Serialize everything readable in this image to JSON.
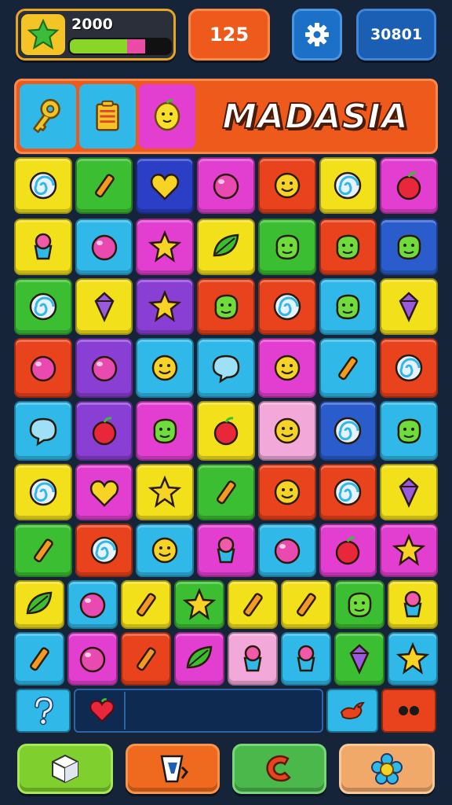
{
  "hud": {
    "score_value": "2000",
    "score_progress": 0.75,
    "score_pink_fraction": 0.18,
    "moves_value": "125",
    "code_value": "30801",
    "gem_icon": "green-star-gem-icon",
    "settings_icon": "gear-icon"
  },
  "title": {
    "text": "MADASIA",
    "tiles": [
      {
        "name": "key-icon",
        "color": "#2fb8e8"
      },
      {
        "name": "crate-icon",
        "color": "#2fb8e8"
      },
      {
        "name": "lemon-face-icon",
        "color": "#e23fd0"
      }
    ]
  },
  "board": {
    "rows": [
      [
        {
          "icon": "swirl-lollipop-icon",
          "color": "#f2e01b"
        },
        {
          "icon": "hammer-icon",
          "color": "#3cbe32"
        },
        {
          "icon": "heart-icon",
          "color": "#2a3ec6"
        },
        {
          "icon": "bubble-gum-icon",
          "color": "#e23fd0"
        },
        {
          "icon": "orange-face-icon",
          "color": "#e8431c"
        },
        {
          "icon": "pie-icon",
          "color": "#f2e01b"
        },
        {
          "icon": "peach-icon",
          "color": "#e23fd0"
        }
      ],
      [
        {
          "icon": "cupcake-icon",
          "color": "#f2e01b"
        },
        {
          "icon": "red-balloon-icon",
          "color": "#2fb8e8"
        },
        {
          "icon": "waffle-flower-icon",
          "color": "#e23fd0"
        },
        {
          "icon": "pepper-icon",
          "color": "#f2e01b"
        },
        {
          "icon": "green-blob-icon",
          "color": "#3cbe32"
        },
        {
          "icon": "owl-candy-icon",
          "color": "#e8431c"
        },
        {
          "icon": "orange-blob-icon",
          "color": "#2a5ccc"
        }
      ],
      [
        {
          "icon": "swirl-candy-icon",
          "color": "#3cbe32"
        },
        {
          "icon": "wrapped-candy-icon",
          "color": "#f2e01b"
        },
        {
          "icon": "crown-icon",
          "color": "#8a3fd4"
        },
        {
          "icon": "spiky-green-icon",
          "color": "#e8431c"
        },
        {
          "icon": "rainbow-swirl-icon",
          "color": "#e8431c"
        },
        {
          "icon": "purple-blob-icon",
          "color": "#2fb8e8"
        },
        {
          "icon": "bottle-icon",
          "color": "#f2e01b"
        }
      ],
      [
        {
          "icon": "balloons-icon",
          "color": "#e8431c"
        },
        {
          "icon": "grape-icon",
          "color": "#8a3fd4"
        },
        {
          "icon": "star-face-icon",
          "color": "#2fb8e8"
        },
        {
          "icon": "speech-bubble-icon",
          "color": "#2fb8e8"
        },
        {
          "icon": "smiley-icon",
          "color": "#e23fd0"
        },
        {
          "icon": "sparkle-stick-icon",
          "color": "#2fb8e8"
        },
        {
          "icon": "red-swirl-icon",
          "color": "#e8431c"
        }
      ],
      [
        {
          "icon": "magnifier-icon",
          "color": "#2fb8e8"
        },
        {
          "icon": "onion-icon",
          "color": "#8a3fd4"
        },
        {
          "icon": "red-splat-icon",
          "color": "#e23fd0"
        },
        {
          "icon": "watermelon-icon",
          "color": "#f2e01b"
        },
        {
          "icon": "cat-face-icon",
          "color": "#f2a8d8"
        },
        {
          "icon": "donut-icon",
          "color": "#2a5ccc"
        },
        {
          "icon": "purple-splat-icon",
          "color": "#2fb8e8"
        }
      ],
      [
        {
          "icon": "red-lollipop-icon",
          "color": "#f2e01b"
        },
        {
          "icon": "green-heart-icon",
          "color": "#e23fd0"
        },
        {
          "icon": "gold-star-icon",
          "color": "#f2e01b"
        },
        {
          "icon": "crayon-icon",
          "color": "#3cbe32"
        },
        {
          "icon": "orange-face-icon",
          "color": "#e8431c"
        },
        {
          "icon": "leaf-swirl-icon",
          "color": "#e8431c"
        },
        {
          "icon": "purple-gem-icon",
          "color": "#f2e01b"
        }
      ],
      [
        {
          "icon": "pencil-icon",
          "color": "#3cbe32"
        },
        {
          "icon": "blue-swirl-icon",
          "color": "#e8431c"
        },
        {
          "icon": "yellow-smiley-icon",
          "color": "#2fb8e8"
        },
        {
          "icon": "fruit-tart-icon",
          "color": "#e23fd0"
        },
        {
          "icon": "plum-icon",
          "color": "#2fb8e8"
        },
        {
          "icon": "apple-icon",
          "color": "#e23fd0"
        },
        {
          "icon": "star-icon",
          "color": "#e23fd0"
        }
      ],
      [
        {
          "icon": "leaf-berry-icon",
          "color": "#f2e01b"
        },
        {
          "icon": "yellow-ball-icon",
          "color": "#2fb8e8"
        },
        {
          "icon": "paddle-icon",
          "color": "#f2e01b"
        },
        {
          "icon": "sun-icon",
          "color": "#3cbe32"
        },
        {
          "icon": "candy-bar-icon",
          "color": "#f2e01b"
        },
        {
          "icon": "purple-pen-icon",
          "color": "#f2e01b"
        },
        {
          "icon": "blue-slime-icon",
          "color": "#3cbe32"
        },
        {
          "icon": "cupcake-icon",
          "color": "#f2e01b"
        }
      ],
      [
        {
          "icon": "crayon-icon",
          "color": "#2fb8e8"
        },
        {
          "icon": "pacifier-icon",
          "color": "#e23fd0"
        },
        {
          "icon": "paintbrush-icon",
          "color": "#e8431c"
        },
        {
          "icon": "green-leaf-icon",
          "color": "#e23fd0"
        },
        {
          "icon": "ice-cream-icon",
          "color": "#f2a8d8"
        },
        {
          "icon": "gift-icon",
          "color": "#2fb8e8"
        },
        {
          "icon": "striped-bottle-icon",
          "color": "#3cbe32"
        },
        {
          "icon": "purple-flower-icon",
          "color": "#2fb8e8"
        }
      ]
    ]
  },
  "strip": {
    "left_icon": "question-icon",
    "heart_icon": "red-heart-icon",
    "bird_icon": "bird-icon",
    "dots_icon": "dots-icon"
  },
  "actions": [
    {
      "icon": "cube-icon",
      "color": "#7fcf2e"
    },
    {
      "icon": "paint-roller-icon",
      "color": "#ef6a1e"
    },
    {
      "icon": "horseshoe-magnet-icon",
      "color": "#4bb84b"
    },
    {
      "icon": "flower-icon",
      "color": "#f1a96a"
    }
  ]
}
